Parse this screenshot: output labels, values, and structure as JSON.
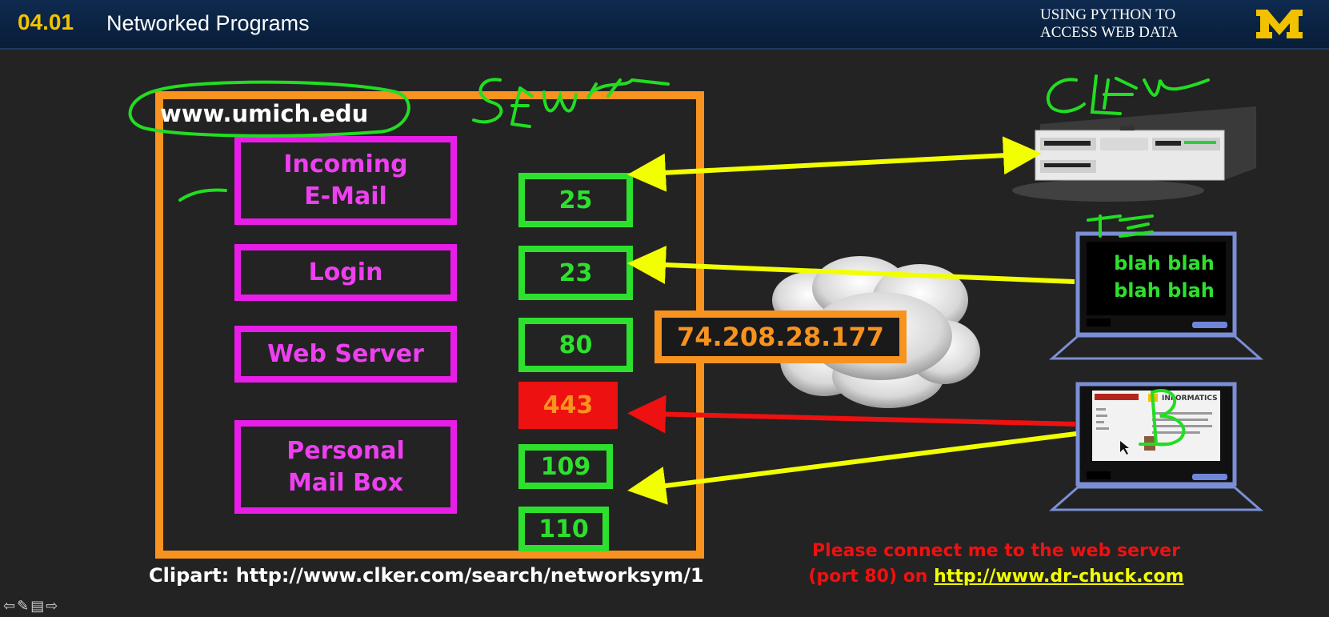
{
  "header": {
    "lesson_number": "04.01",
    "lesson_title": "Networked Programs",
    "course_title_line1": "USING PYTHON TO",
    "course_title_line2": "ACCESS WEB DATA",
    "logo_letter": "M"
  },
  "slide": {
    "host": "www.umich.edu",
    "services": [
      {
        "line1": "Incoming",
        "line2": "E-Mail"
      },
      {
        "line1": "Login",
        "line2": ""
      },
      {
        "line1": "Web Server",
        "line2": ""
      },
      {
        "line1": "Personal",
        "line2": "Mail Box"
      }
    ],
    "ports": [
      "25",
      "23",
      "80",
      "443",
      "109",
      "110"
    ],
    "ip_address": "74.208.28.177",
    "laptop_text_line1": "blah blah",
    "laptop_text_line2": "blah blah",
    "browser_site_name": "INFORMATICS",
    "clipart_credit": "Clipart: http://www.clker.com/search/networksym/1",
    "request_line1": "Please connect me to the web server",
    "request_line2_prefix": "(port 80) on ",
    "request_link": "http://www.dr-chuck.com"
  },
  "colors": {
    "accent_orange": "#f7931e",
    "service_magenta": "#e81ee8",
    "port_green": "#2ee02e",
    "secure_red": "#ee1111",
    "arrow_yellow": "#f2ff00",
    "annotation_green": "#22dd22",
    "header_navy": "#0e2a4f",
    "header_gold": "#f2c200"
  },
  "icons": [
    "back-arrow-icon",
    "pen-icon",
    "menu-icon",
    "forward-arrow-icon"
  ]
}
